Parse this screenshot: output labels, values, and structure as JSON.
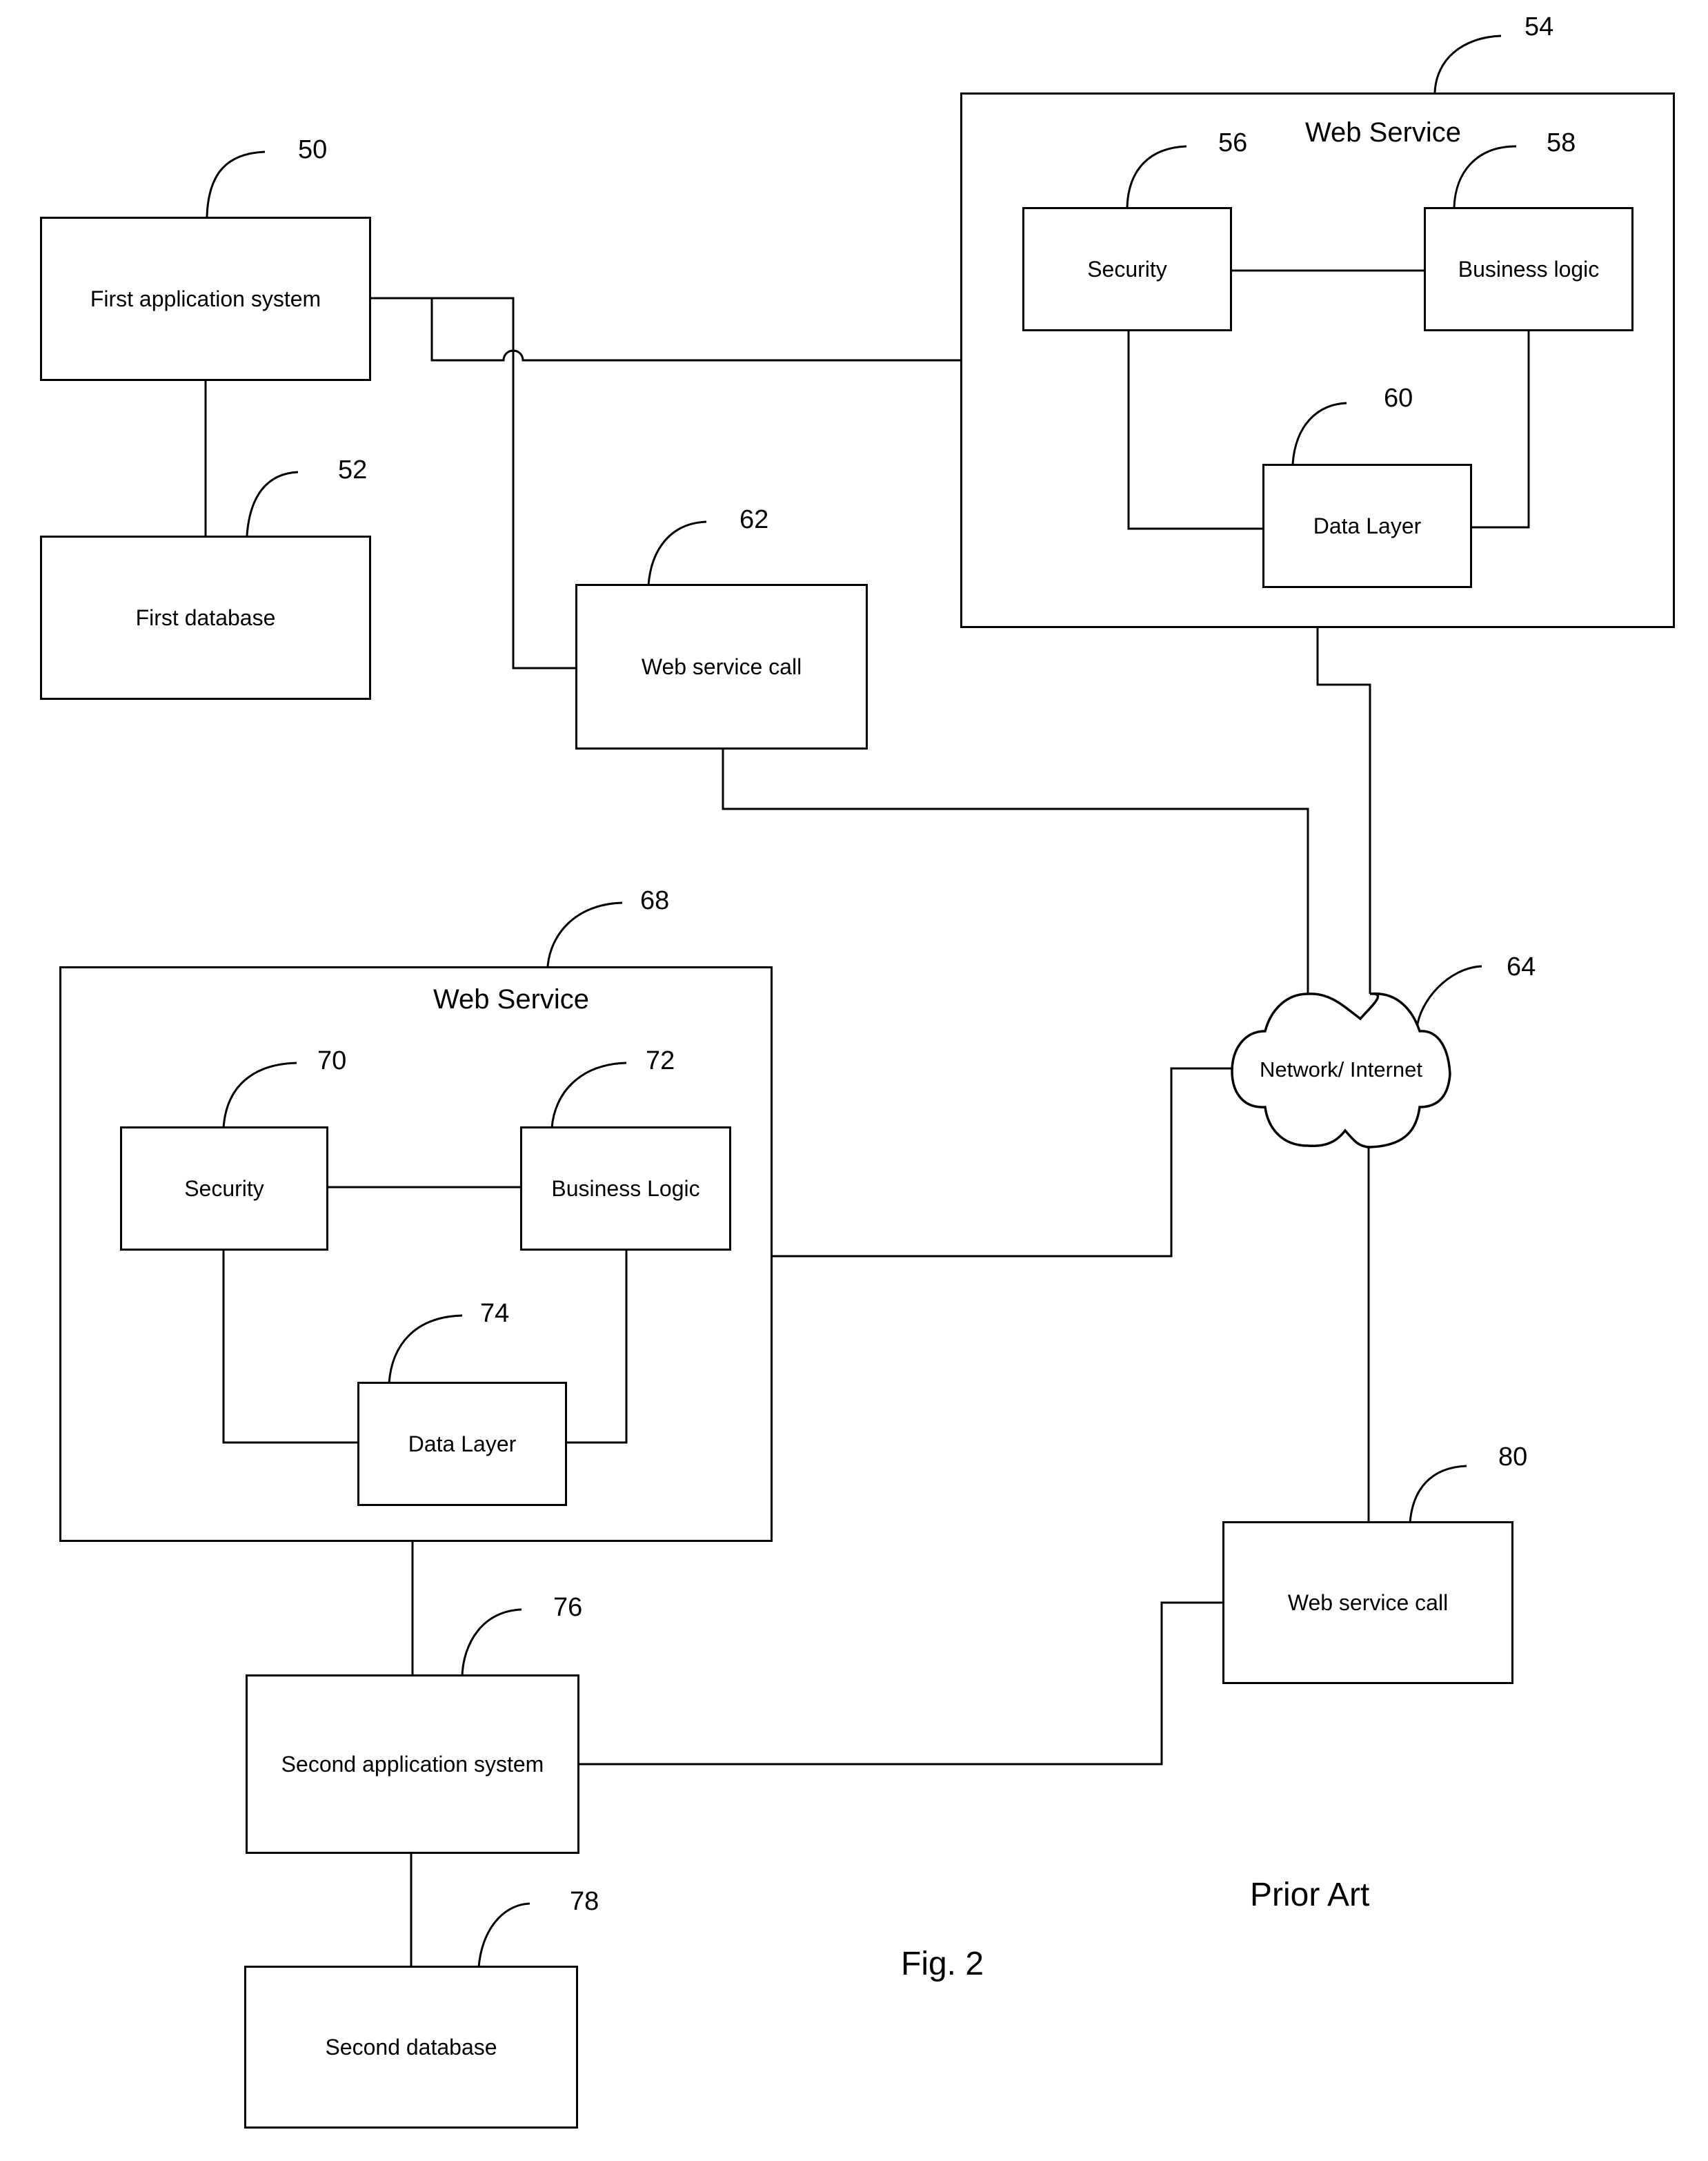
{
  "figure": {
    "caption": "Fig. 2",
    "note": "Prior Art"
  },
  "nodes": {
    "first_app": {
      "ref": "50",
      "label": "First application system"
    },
    "first_db": {
      "ref": "52",
      "label": "First database"
    },
    "ws1": {
      "ref": "54",
      "title": "Web Service",
      "security": {
        "ref": "56",
        "label": "Security"
      },
      "business": {
        "ref": "58",
        "label": "Business logic"
      },
      "data": {
        "ref": "60",
        "label": "Data Layer"
      }
    },
    "wscall1": {
      "ref": "62",
      "label": "Web service call"
    },
    "network": {
      "ref": "64",
      "label": "Network/ Internet"
    },
    "ws2": {
      "ref": "68",
      "title": "Web Service",
      "security": {
        "ref": "70",
        "label": "Security"
      },
      "business": {
        "ref": "72",
        "label": "Business Logic"
      },
      "data": {
        "ref": "74",
        "label": "Data Layer"
      }
    },
    "second_app": {
      "ref": "76",
      "label": "Second application system"
    },
    "second_db": {
      "ref": "78",
      "label": "Second database"
    },
    "wscall2": {
      "ref": "80",
      "label": "Web service call"
    }
  }
}
